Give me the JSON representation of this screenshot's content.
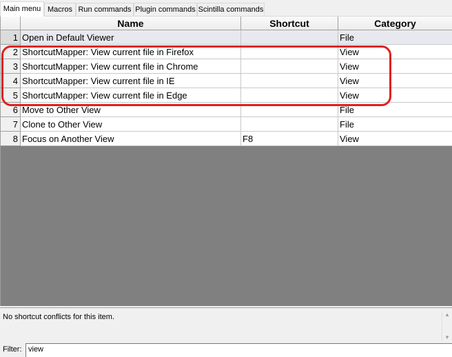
{
  "tabs": [
    {
      "label": "Main menu",
      "active": true
    },
    {
      "label": "Macros",
      "active": false
    },
    {
      "label": "Run commands",
      "active": false
    },
    {
      "label": "Plugin commands",
      "active": false
    },
    {
      "label": "Scintilla commands",
      "active": false
    }
  ],
  "table": {
    "columns": [
      "Name",
      "Shortcut",
      "Category"
    ],
    "rows": [
      {
        "num": "1",
        "name": "Open in Default Viewer",
        "shortcut": "",
        "category": "File"
      },
      {
        "num": "2",
        "name": "ShortcutMapper: View current file in Firefox",
        "shortcut": "",
        "category": "View"
      },
      {
        "num": "3",
        "name": "ShortcutMapper: View current file in Chrome",
        "shortcut": "",
        "category": "View"
      },
      {
        "num": "4",
        "name": "ShortcutMapper: View current file in IE",
        "shortcut": "",
        "category": "View"
      },
      {
        "num": "5",
        "name": "ShortcutMapper: View current file in Edge",
        "shortcut": "",
        "category": "View"
      },
      {
        "num": "6",
        "name": "Move to Other View",
        "shortcut": "",
        "category": "File"
      },
      {
        "num": "7",
        "name": "Clone to Other View",
        "shortcut": "",
        "category": "File"
      },
      {
        "num": "8",
        "name": "Focus on Another View",
        "shortcut": "F8",
        "category": "View"
      }
    ]
  },
  "conflict": {
    "message": "No shortcut conflicts for this item."
  },
  "filter": {
    "label": "Filter:",
    "value": "view"
  },
  "colors": {
    "highlight": "#e02020",
    "grid_background": "#808080"
  }
}
